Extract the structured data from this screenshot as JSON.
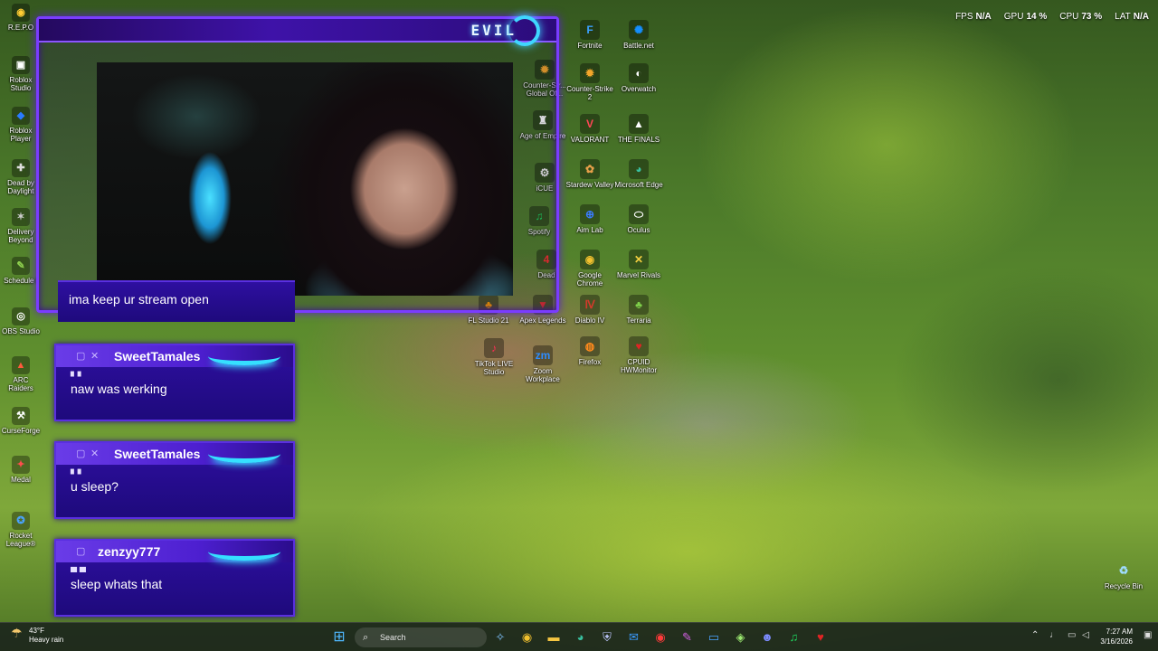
{
  "perf": {
    "fps_label": "FPS",
    "fps_value": "N/A",
    "gpu_label": "GPU",
    "gpu_value": "14 %",
    "cpu_label": "CPU",
    "cpu_value": "73 %",
    "lat_label": "LAT",
    "lat_value": "N/A"
  },
  "overlay": {
    "logo": "EVIL",
    "stream_note": "ima keep ur stream open"
  },
  "chat": [
    {
      "user": "SweetTamales",
      "dots": "▘▘",
      "message": "naw was werking"
    },
    {
      "user": "SweetTamales",
      "dots": "▘▘",
      "message": "u sleep?"
    },
    {
      "user": "zenzyy777",
      "dots": "▀ ▀",
      "message": "sleep whats that"
    }
  ],
  "left_icons": [
    {
      "label": "R.E.P.O",
      "icon": "repo-icon",
      "glyph": "◉",
      "color": "#ffcc33"
    },
    {
      "label": "Roblox Studio",
      "icon": "roblox-studio-icon",
      "glyph": "▣",
      "color": "#ffffff"
    },
    {
      "label": "Roblox Player",
      "icon": "roblox-player-icon",
      "glyph": "◆",
      "color": "#2a7bff"
    },
    {
      "label": "Dead by Daylight",
      "icon": "dead-by-daylight-icon",
      "glyph": "✚",
      "color": "#dddddd"
    },
    {
      "label": "Delivery Beyond",
      "icon": "delivery-beyond-icon",
      "glyph": "✶",
      "color": "#cccccc"
    },
    {
      "label": "Schedule I",
      "icon": "schedule-icon",
      "glyph": "✎",
      "color": "#8fd14f"
    },
    {
      "label": "OBS Studio",
      "icon": "obs-studio-icon",
      "glyph": "◎",
      "color": "#ffffff"
    },
    {
      "label": "ARC Raiders",
      "icon": "arc-raiders-icon",
      "glyph": "▲",
      "color": "#ff5a3c"
    },
    {
      "label": "CurseForge",
      "icon": "curseforge-icon",
      "glyph": "⚒",
      "color": "#ffffff"
    },
    {
      "label": "Medal",
      "icon": "medal-icon",
      "glyph": "✦",
      "color": "#ff4d4d"
    },
    {
      "label": "Rocket League®",
      "icon": "rocket-league-icon",
      "glyph": "✪",
      "color": "#4aa3ff"
    }
  ],
  "partial_icons": [
    {
      "label": "Counter-Str... Global Of...",
      "icon": "counter-strike-go-icon",
      "glyph": "✹",
      "color": "#f4a62a"
    },
    {
      "label": "Age of Empire",
      "icon": "age-of-empires-icon",
      "glyph": "♜",
      "color": "#ffffff"
    },
    {
      "label": "iCUE",
      "icon": "icue-icon",
      "glyph": "⚙",
      "color": "#eeeeee"
    },
    {
      "label": "Spotify",
      "icon": "spotify-icon",
      "glyph": "♫",
      "color": "#1ed760"
    },
    {
      "label": "Dead",
      "icon": "dead-island-icon",
      "glyph": "4",
      "color": "#ff3030"
    },
    {
      "label": "FL Studio 21",
      "icon": "fl-studio-icon",
      "glyph": "♣",
      "color": "#ff9d00"
    },
    {
      "label": "Apex Legends",
      "icon": "apex-legends-icon",
      "glyph": "▼",
      "color": "#e03030"
    },
    {
      "label": "TikTok LIVE Studio",
      "icon": "tiktok-live-studio-icon",
      "glyph": "♪",
      "color": "#ff2d55"
    },
    {
      "label": "Zoom Workplace",
      "icon": "zoom-icon",
      "glyph": "zm",
      "color": "#2d8cff"
    }
  ],
  "grid_icons": [
    {
      "label": "Fortnite",
      "icon": "fortnite-icon",
      "glyph": "F",
      "color": "#3aa0ff"
    },
    {
      "label": "Battle.net",
      "icon": "battle-net-icon",
      "glyph": "✺",
      "color": "#148eff"
    },
    {
      "label": "Counter-Strike 2",
      "icon": "counter-strike-2-icon",
      "glyph": "✹",
      "color": "#f4a62a"
    },
    {
      "label": "Overwatch",
      "icon": "overwatch-icon",
      "glyph": "◐",
      "color": "#ffffff"
    },
    {
      "label": "VALORANT",
      "icon": "valorant-icon",
      "glyph": "V",
      "color": "#ff4655"
    },
    {
      "label": "THE FINALS",
      "icon": "the-finals-icon",
      "glyph": "▲",
      "color": "#ffffff"
    },
    {
      "label": "Stardew Valley",
      "icon": "stardew-valley-icon",
      "glyph": "✿",
      "color": "#e8a04a"
    },
    {
      "label": "Microsoft Edge",
      "icon": "microsoft-edge-icon",
      "glyph": "◕",
      "color": "#39c0a0"
    },
    {
      "label": "Aim Lab",
      "icon": "aim-lab-icon",
      "glyph": "⊕",
      "color": "#3a7bff"
    },
    {
      "label": "Oculus",
      "icon": "oculus-icon",
      "glyph": "⬭",
      "color": "#ffffff"
    },
    {
      "label": "Google Chrome",
      "icon": "google-chrome-icon",
      "glyph": "◉",
      "color": "#f2c12e"
    },
    {
      "label": "Marvel Rivals",
      "icon": "marvel-rivals-icon",
      "glyph": "✕",
      "color": "#f5d040"
    },
    {
      "label": "Diablo IV",
      "icon": "diablo-iv-icon",
      "glyph": "Ⅳ",
      "color": "#d23b2b"
    },
    {
      "label": "Terraria",
      "icon": "terraria-icon",
      "glyph": "♣",
      "color": "#7fd04a"
    },
    {
      "label": "Firefox",
      "icon": "firefox-icon",
      "glyph": "◍",
      "color": "#ff8a1c"
    },
    {
      "label": "CPUID HWMonitor",
      "icon": "hwmonitor-icon",
      "glyph": "♥",
      "color": "#e02424"
    }
  ],
  "recycle_bin": {
    "label": "Recycle Bin",
    "icon": "recycle-bin-icon",
    "glyph": "♻",
    "color": "#9fdcff"
  },
  "taskbar": {
    "weather_temp": "43°F",
    "weather_desc": "Heavy rain",
    "search_placeholder": "Search",
    "apps": [
      {
        "name": "copilot-icon",
        "glyph": "✧",
        "color": "#7fc4ff"
      },
      {
        "name": "chrome-icon",
        "glyph": "◉",
        "color": "#f2c12e"
      },
      {
        "name": "file-explorer-icon",
        "glyph": "▬",
        "color": "#f5c542"
      },
      {
        "name": "edge-icon",
        "glyph": "◕",
        "color": "#39c0a0"
      },
      {
        "name": "shield-icon",
        "glyph": "⛨",
        "color": "#bfc8ff"
      },
      {
        "name": "outlook-icon",
        "glyph": "✉",
        "color": "#3a9bff"
      },
      {
        "name": "record-icon",
        "glyph": "◉",
        "color": "#ff3a3a"
      },
      {
        "name": "editor-icon",
        "glyph": "✎",
        "color": "#d060e0"
      },
      {
        "name": "monitor-icon",
        "glyph": "▭",
        "color": "#4aa3ff"
      },
      {
        "name": "chat-app-icon",
        "glyph": "◈",
        "color": "#9be870"
      },
      {
        "name": "discord-icon",
        "glyph": "☻",
        "color": "#7d8cff"
      },
      {
        "name": "spotify-icon",
        "glyph": "♫",
        "color": "#1ed760"
      },
      {
        "name": "hwmonitor-icon",
        "glyph": "♥",
        "color": "#e02424"
      }
    ],
    "time": "7:27 AM",
    "date": "3/16/2026"
  }
}
